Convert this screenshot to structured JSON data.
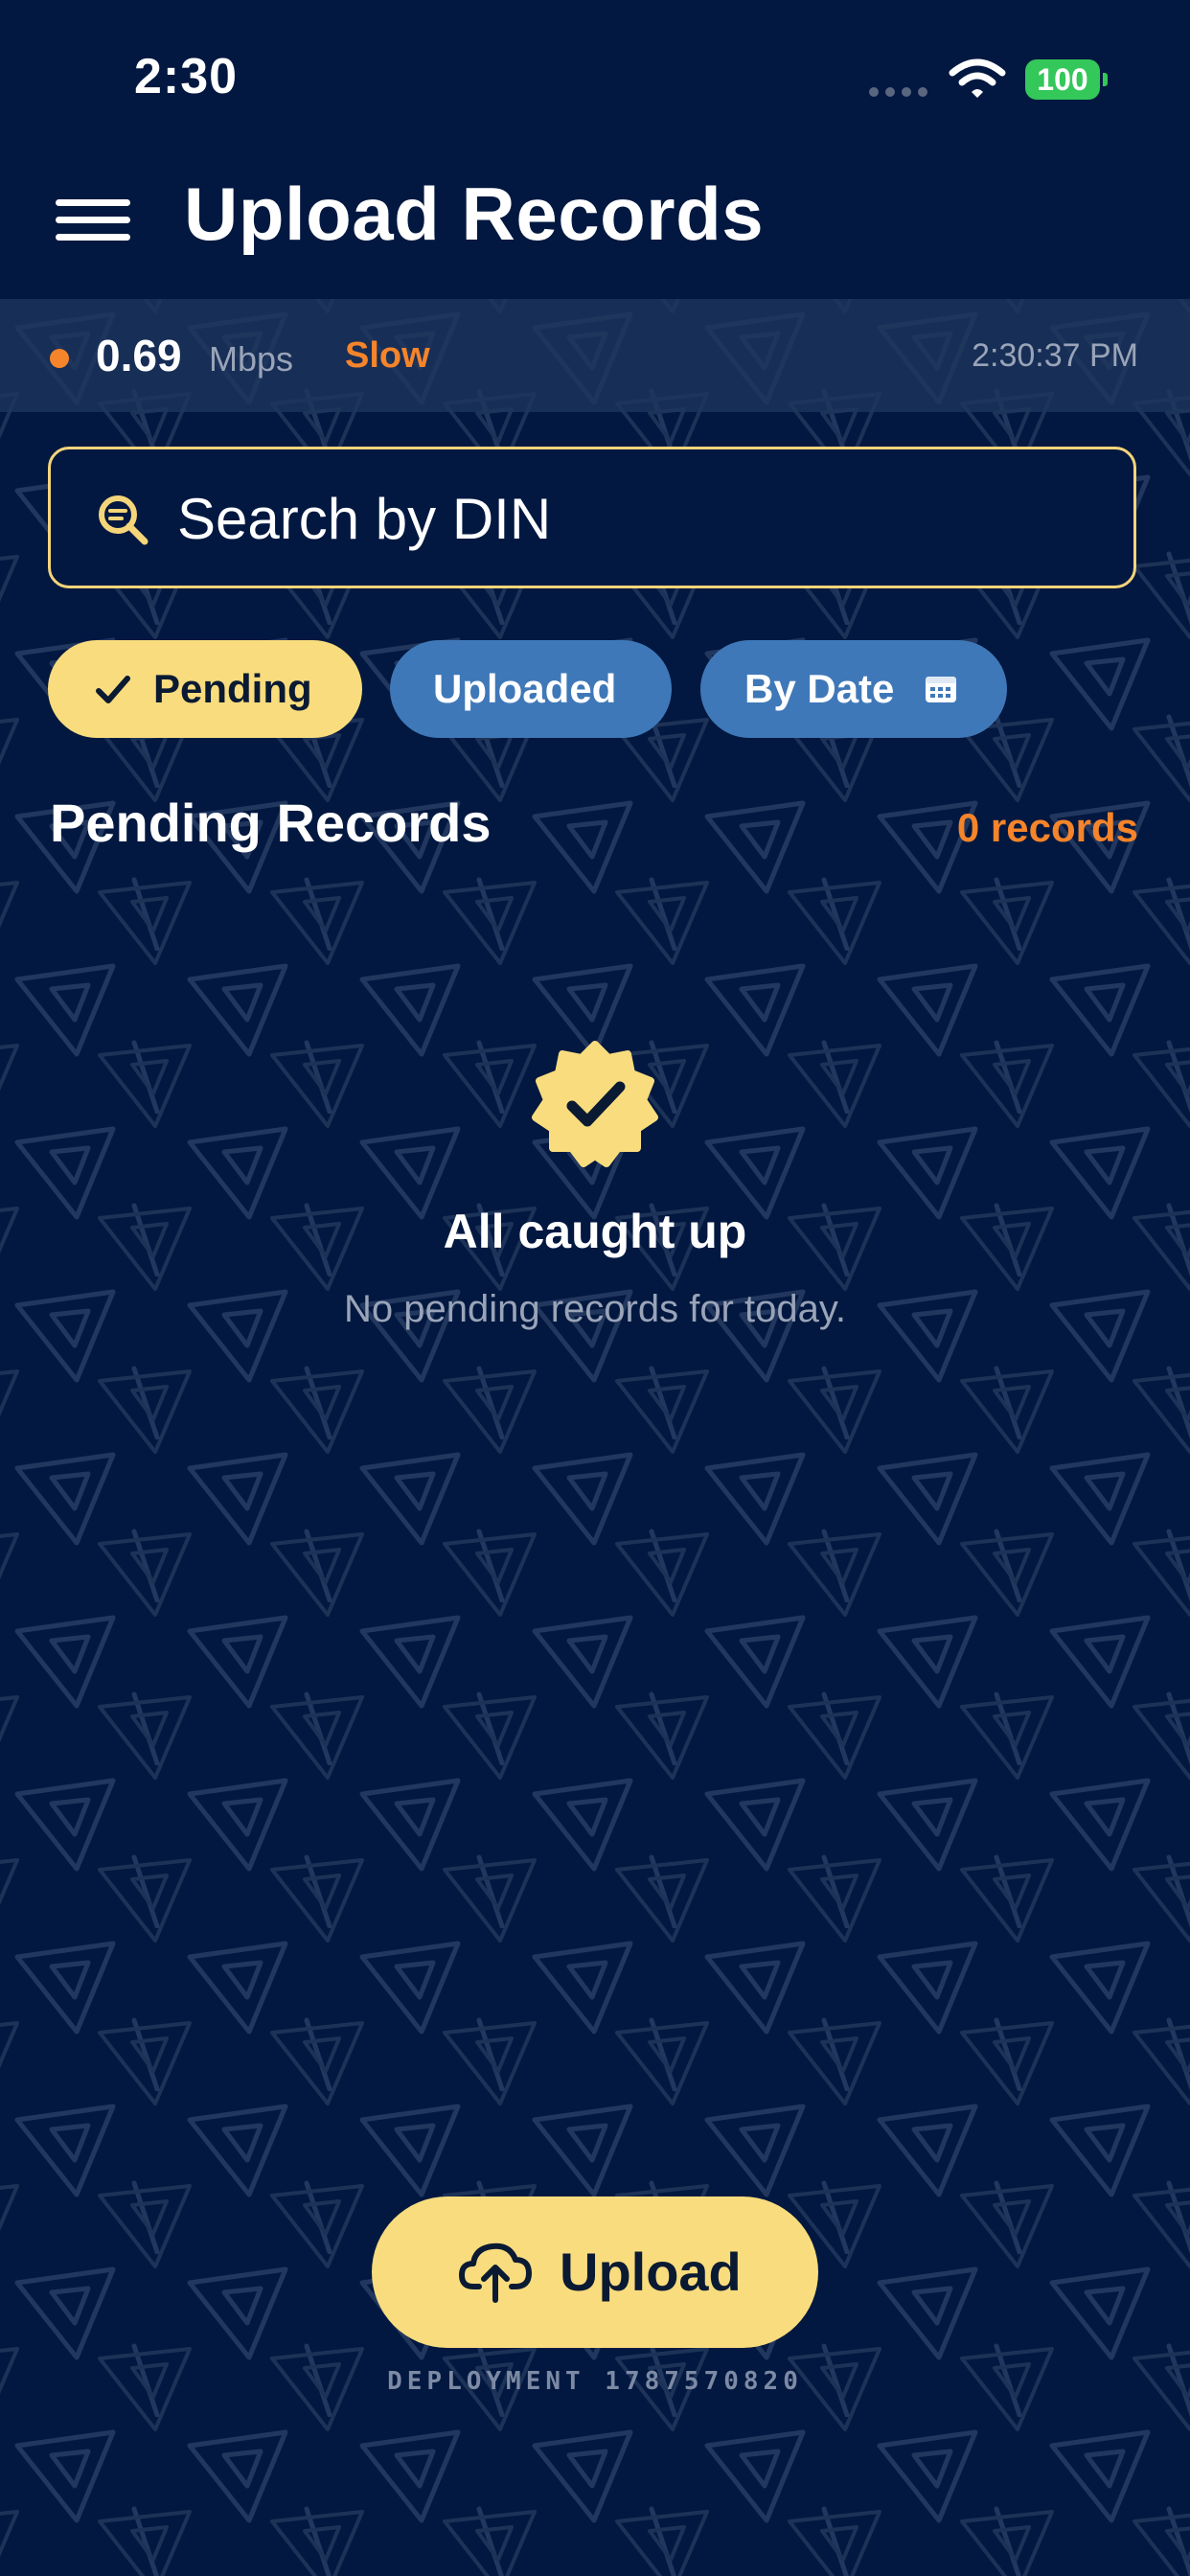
{
  "status_bar": {
    "time": "2:30",
    "battery": "100"
  },
  "header": {
    "title": "Upload Records"
  },
  "connection": {
    "speed": "0.69",
    "unit": "Mbps",
    "quality": "Slow",
    "timestamp": "2:30:37 PM"
  },
  "search": {
    "placeholder": "Search by DIN",
    "value": ""
  },
  "filters": [
    {
      "label": "Pending",
      "selected": true
    },
    {
      "label": "Uploaded",
      "selected": false
    },
    {
      "label": "By Date",
      "selected": false
    }
  ],
  "section": {
    "title": "Pending Records",
    "count": "0 records"
  },
  "empty_state": {
    "title": "All caught up",
    "subtitle": "No pending records for today."
  },
  "upload_button": {
    "label": "Upload"
  },
  "deployment": {
    "text": "DEPLOYMENT 1787570820"
  },
  "colors": {
    "background": "#021840",
    "accent_yellow": "#f9dc7d",
    "accent_orange": "#f5842a",
    "chip_blue": "#3f78b8",
    "battery_green": "#34c759"
  },
  "icons": {
    "menu": "hamburger-menu-icon",
    "search": "search-icon",
    "check": "check-icon",
    "calendar": "calendar-icon",
    "badge": "verified-badge-icon",
    "upload": "cloud-upload-icon",
    "wifi": "wifi-icon",
    "signal": "signal-dots-icon"
  }
}
